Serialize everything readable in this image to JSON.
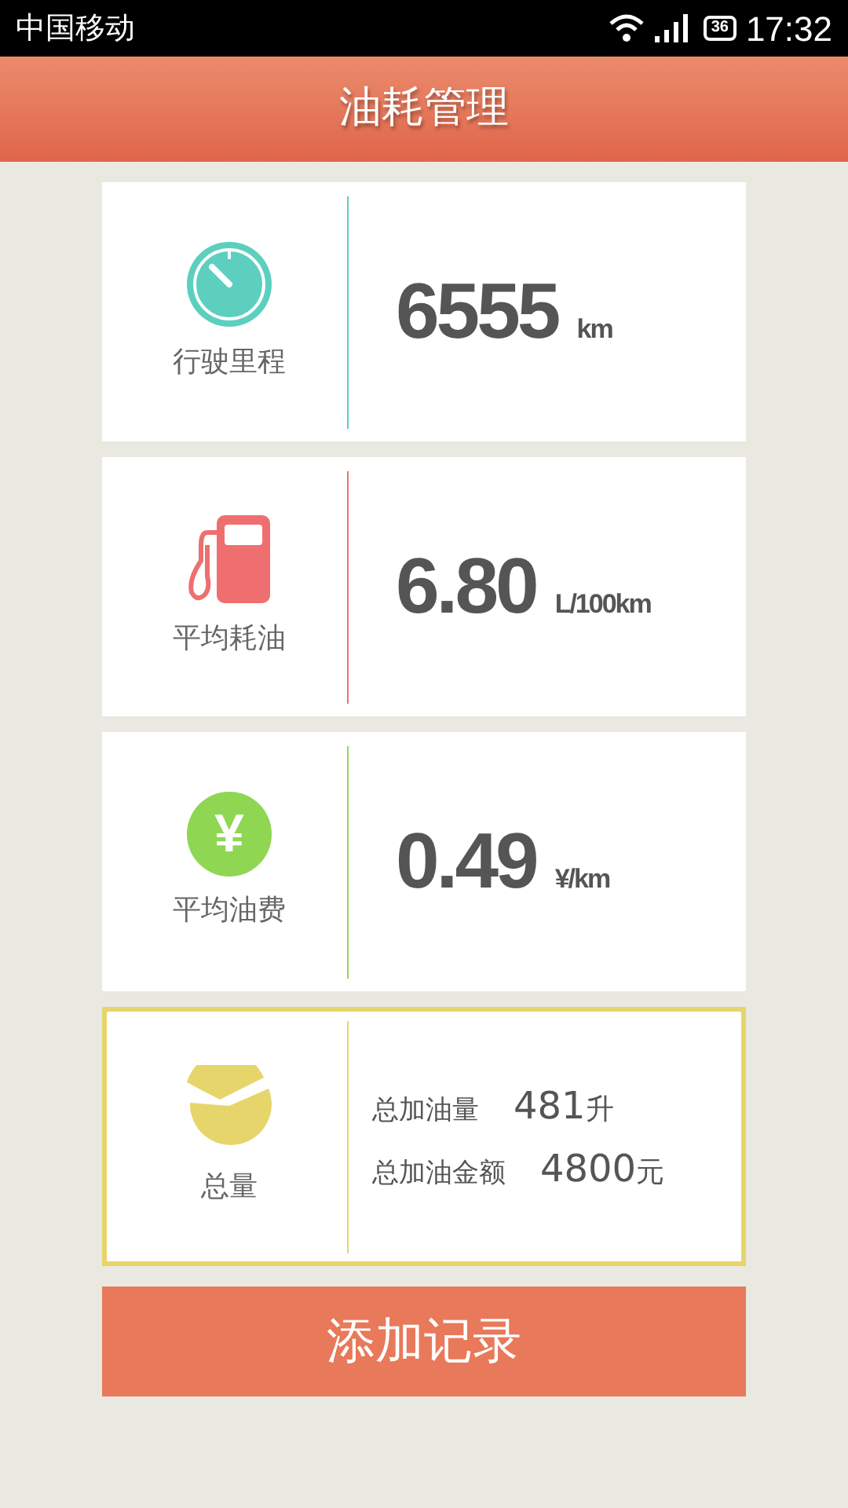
{
  "status_bar": {
    "carrier": "中国移动",
    "battery": "36",
    "time": "17:32"
  },
  "header": {
    "title": "油耗管理"
  },
  "cards": [
    {
      "kind": "mileage",
      "label": "行驶里程",
      "color": "#5ccfbf",
      "selected": false,
      "value": "6555",
      "unit": "km"
    },
    {
      "kind": "fuel",
      "label": "平均耗油",
      "color": "#ef6f70",
      "selected": false,
      "value": "6.80",
      "unit": "L/100km"
    },
    {
      "kind": "cost",
      "label": "平均油费",
      "color": "#8fd653",
      "selected": false,
      "icon_text": "¥",
      "value": "0.49",
      "unit": "¥/km"
    },
    {
      "kind": "total",
      "label": "总量",
      "color": "#e6d56a",
      "selected": true,
      "rows": [
        {
          "label": "总加油量",
          "value": "481",
          "unit": "升"
        },
        {
          "label": "总加油金额",
          "value": "4800",
          "unit": "元"
        }
      ]
    }
  ],
  "add_button": {
    "label": "添加记录"
  }
}
